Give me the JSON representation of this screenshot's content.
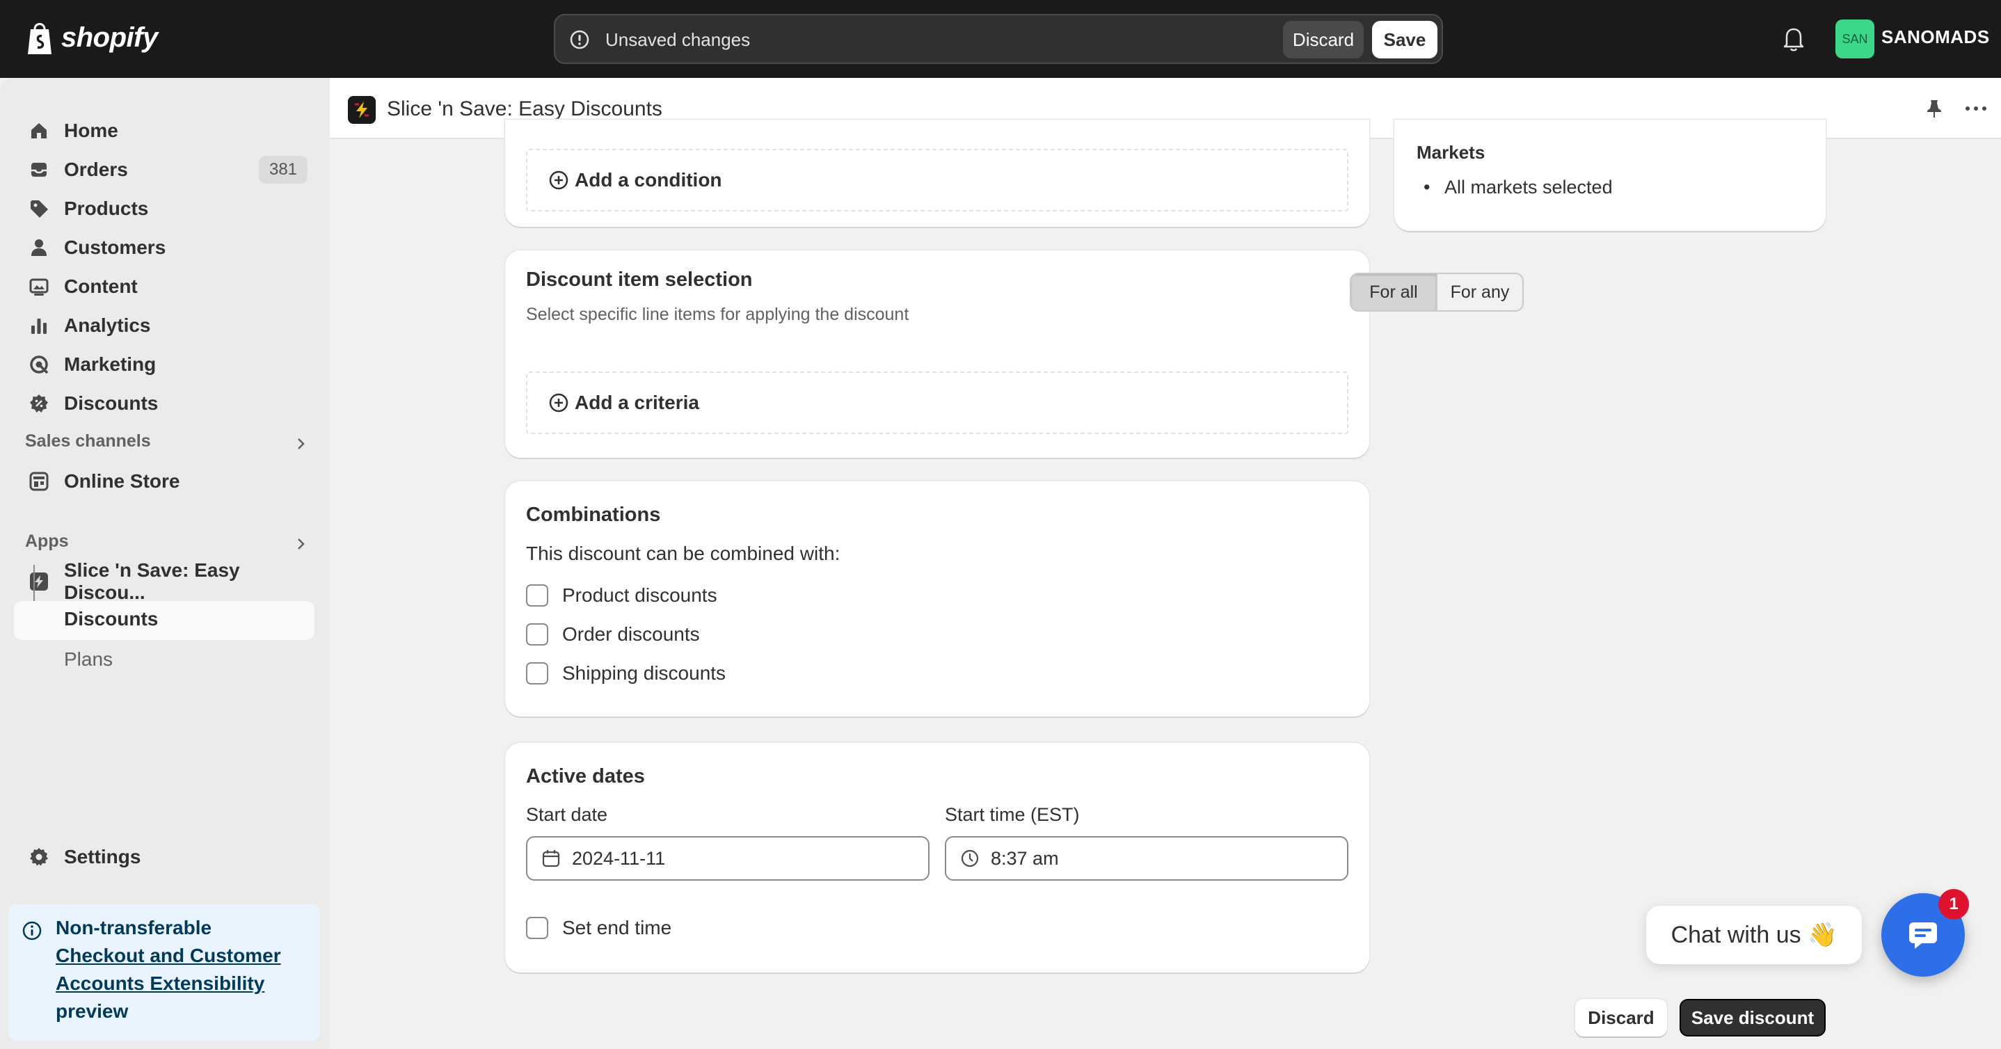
{
  "topbar": {
    "brand": "shopify",
    "unsaved_text": "Unsaved changes",
    "discard_label": "Discard",
    "save_label": "Save",
    "store_initials": "SAN",
    "store_name": "SANOMADS"
  },
  "sidebar": {
    "items": [
      {
        "label": "Home",
        "icon": "home-icon"
      },
      {
        "label": "Orders",
        "icon": "orders-icon",
        "badge": "381"
      },
      {
        "label": "Products",
        "icon": "tag-icon"
      },
      {
        "label": "Customers",
        "icon": "person-icon"
      },
      {
        "label": "Content",
        "icon": "content-icon"
      },
      {
        "label": "Analytics",
        "icon": "bar-chart-icon"
      },
      {
        "label": "Marketing",
        "icon": "target-icon"
      },
      {
        "label": "Discounts",
        "icon": "discount-icon"
      }
    ],
    "sales_channels_label": "Sales channels",
    "online_store_label": "Online Store",
    "apps_label": "Apps",
    "app_name": "Slice 'n Save: Easy Discou...",
    "app_sub_active": "Discounts",
    "app_sub_plans": "Plans",
    "settings_label": "Settings",
    "notice": {
      "line1": "Non-transferable",
      "link": "Checkout and Customer Accounts Extensibility",
      "line3": "preview"
    }
  },
  "app_header": {
    "title": "Slice 'n Save: Easy Discounts"
  },
  "conditions_card": {
    "add_condition_label": "Add a condition"
  },
  "item_selection_card": {
    "title": "Discount item selection",
    "subtitle": "Select specific line items for applying the discount",
    "segment_options": [
      "For all",
      "For any"
    ],
    "segment_selected": "For all",
    "add_criteria_label": "Add a criteria"
  },
  "combinations_card": {
    "title": "Combinations",
    "subtitle": "This discount can be combined with:",
    "options": [
      {
        "label": "Product discounts",
        "checked": false
      },
      {
        "label": "Order discounts",
        "checked": false
      },
      {
        "label": "Shipping discounts",
        "checked": false
      }
    ]
  },
  "active_dates_card": {
    "title": "Active dates",
    "start_date_label": "Start date",
    "start_date_value": "2024-11-11",
    "start_time_label": "Start time (EST)",
    "start_time_value": "8:37 am",
    "end_time_label": "Set end time",
    "end_time_checked": false
  },
  "markets_card": {
    "title": "Markets",
    "item": "All markets selected"
  },
  "chat": {
    "label": "Chat with us 👋",
    "badge": "1"
  },
  "footer": {
    "discard_label": "Discard",
    "save_label": "Save discount"
  },
  "colors": {
    "topbar_bg": "#1a1a1a",
    "primary_button": "#303030",
    "chat_blue": "#2d6fe8",
    "badge_red": "#e0132e",
    "store_badge_green": "#3cd889",
    "notice_bg": "#eaf4ff"
  }
}
